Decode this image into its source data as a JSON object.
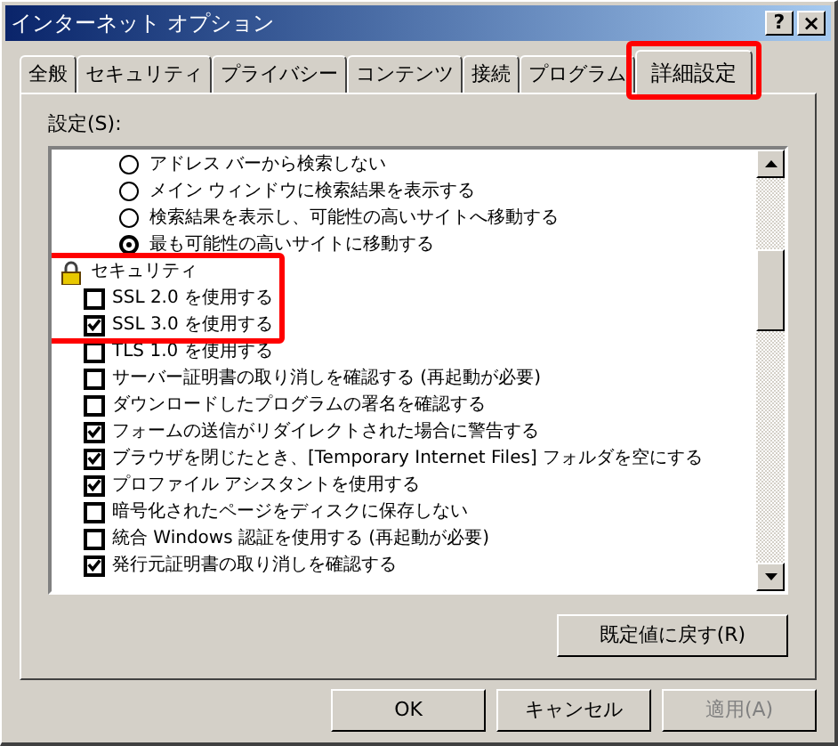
{
  "window": {
    "title": "インターネット オプション",
    "help_button": "?",
    "close_button": "×"
  },
  "tabs": [
    {
      "label": "全般",
      "selected": false
    },
    {
      "label": "セキュリティ",
      "selected": false
    },
    {
      "label": "プライバシー",
      "selected": false
    },
    {
      "label": "コンテンツ",
      "selected": false
    },
    {
      "label": "接続",
      "selected": false
    },
    {
      "label": "プログラム",
      "selected": false
    },
    {
      "label": "詳細設定",
      "selected": true
    }
  ],
  "settings_label": "設定(S):",
  "settings": [
    {
      "kind": "radio",
      "label": "アドレス バーから検索しない",
      "selected": false
    },
    {
      "kind": "radio",
      "label": "メイン ウィンドウに検索結果を表示する",
      "selected": false
    },
    {
      "kind": "radio",
      "label": "検索結果を表示し、可能性の高いサイトへ移動する",
      "selected": false
    },
    {
      "kind": "radio",
      "label": "最も可能性の高いサイトに移動する",
      "selected": true
    },
    {
      "kind": "group",
      "label": "セキュリティ"
    },
    {
      "kind": "checkbox",
      "label": "SSL 2.0 を使用する",
      "checked": false
    },
    {
      "kind": "checkbox",
      "label": "SSL 3.0 を使用する",
      "checked": true
    },
    {
      "kind": "checkbox",
      "label": "TLS 1.0 を使用する",
      "checked": false
    },
    {
      "kind": "checkbox",
      "label": "サーバー証明書の取り消しを確認する (再起動が必要)",
      "checked": false
    },
    {
      "kind": "checkbox",
      "label": "ダウンロードしたプログラムの署名を確認する",
      "checked": false
    },
    {
      "kind": "checkbox",
      "label": "フォームの送信がリダイレクトされた場合に警告する",
      "checked": true
    },
    {
      "kind": "checkbox",
      "label": "ブラウザを閉じたとき、[Temporary Internet Files] フォルダを空にする",
      "checked": true
    },
    {
      "kind": "checkbox",
      "label": "プロファイル アシスタントを使用する",
      "checked": true
    },
    {
      "kind": "checkbox",
      "label": "暗号化されたページをディスクに保存しない",
      "checked": false
    },
    {
      "kind": "checkbox",
      "label": "統合 Windows 認証を使用する (再起動が必要)",
      "checked": false
    },
    {
      "kind": "checkbox",
      "label": "発行元証明書の取り消しを確認する",
      "checked": true
    }
  ],
  "restore_button": "既定値に戻す(R)",
  "buttons": [
    {
      "label": "OK",
      "disabled": false
    },
    {
      "label": "キャンセル",
      "disabled": false
    },
    {
      "label": "適用(A)",
      "disabled": true
    }
  ]
}
